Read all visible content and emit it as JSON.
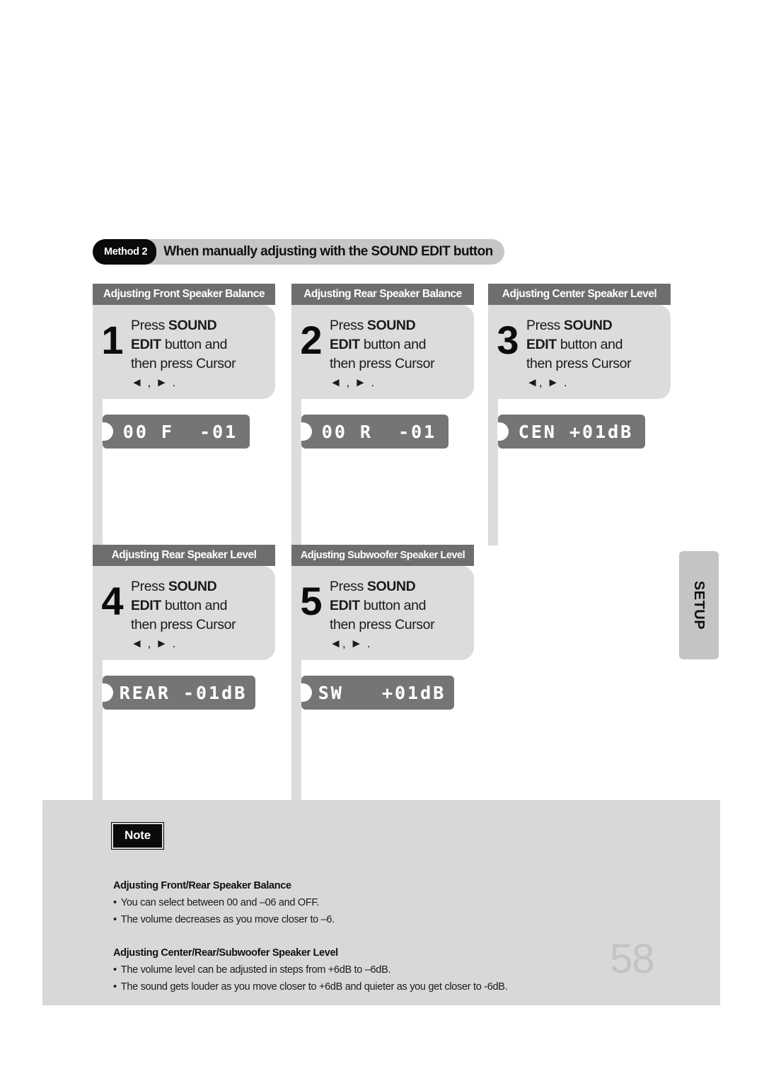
{
  "method_banner": {
    "badge": "Method 2",
    "title": "When manually adjusting with the SOUND EDIT button"
  },
  "columns": [
    {
      "header": "Adjusting Front Speaker Balance",
      "step_number": "1",
      "line1_pre": "Press ",
      "line1_bold": "SOUND",
      "line2_bold": "EDIT",
      "line2_post": " button and",
      "line3": "then press Cursor",
      "cursor_line": "◄ , ► .",
      "lcd": "00 F  -01"
    },
    {
      "header": "Adjusting Rear Speaker Balance",
      "step_number": "2",
      "line1_pre": "Press ",
      "line1_bold": "SOUND",
      "line2_bold": "EDIT",
      "line2_post": " button and",
      "line3": "then press Cursor",
      "cursor_line": "◄ , ► .",
      "lcd": "00 R  -01"
    },
    {
      "header": "Adjusting Center Speaker Level",
      "step_number": "3",
      "line1_pre": "Press ",
      "line1_bold": "SOUND",
      "line2_bold": "EDIT",
      "line2_post": " button and",
      "line3": "then press Cursor",
      "cursor_line": "◄, ► .",
      "lcd": "CEN +01dB"
    },
    {
      "header": "Adjusting Rear Speaker Level",
      "step_number": "4",
      "line1_pre": "Press ",
      "line1_bold": "SOUND",
      "line2_bold": "EDIT",
      "line2_post": " button and",
      "line3": "then press Cursor",
      "cursor_line": "◄ , ► .",
      "lcd": "REAR -01dB"
    },
    {
      "header": "Adjusting Subwoofer Speaker Level",
      "step_number": "5",
      "line1_pre": "Press ",
      "line1_bold": "SOUND",
      "line2_bold": "EDIT",
      "line2_post": " button and",
      "line3": "then press Cursor",
      "cursor_line": "◄, ► .",
      "lcd": "SW   +01dB"
    }
  ],
  "setup_tab": {
    "label": "SETUP"
  },
  "note": {
    "badge": "Note",
    "section1_title": "Adjusting Front/Rear Speaker Balance",
    "section1_items": [
      "You can select between 00 and –06 and OFF.",
      "The volume decreases as you move closer to –6."
    ],
    "section2_title": "Adjusting Center/Rear/Subwoofer Speaker Level",
    "section2_items": [
      "The volume level can be adjusted in steps from +6dB to –6dB.",
      "The sound gets louder as you move closer to +6dB and quieter as you get closer to -6dB."
    ],
    "bullet": "•"
  },
  "page_number": "58",
  "colors": {
    "header_bar": "#6e6e6e",
    "card_bg": "#dcdcdc",
    "lcd_bg": "#757575",
    "note_bg": "#d8d8d8",
    "badge_bg": "#0a0a0a",
    "page_number": "#c3c3c3"
  }
}
